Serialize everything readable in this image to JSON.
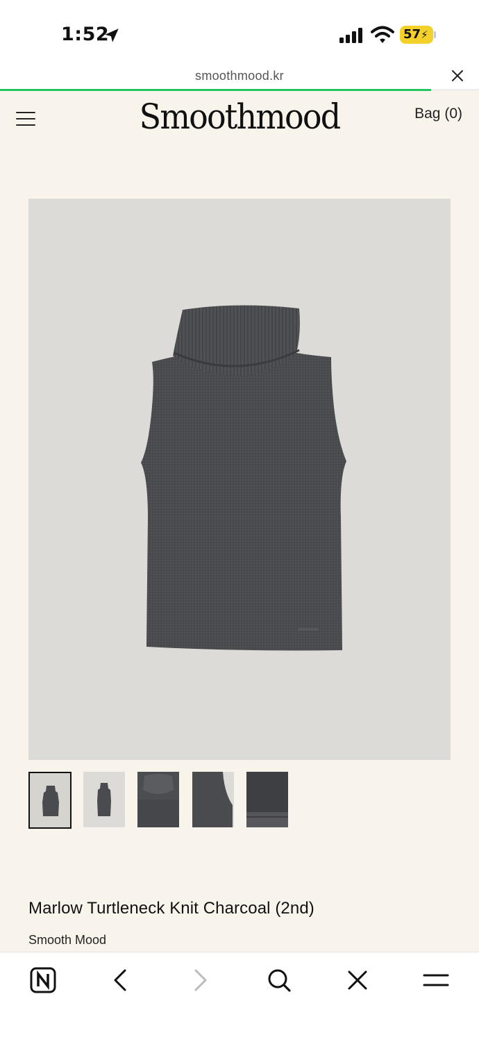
{
  "status_bar": {
    "time": "1:52",
    "battery": "57"
  },
  "browser": {
    "url": "smoothmood.kr",
    "load_progress": 0.9
  },
  "header": {
    "logo": "Smoothmood",
    "bag_label": "Bag (0)"
  },
  "product": {
    "title": "Marlow Turtleneck Knit Charcoal (2nd)",
    "brand": "Smooth Mood",
    "thumbnails": [
      "front-view",
      "front-view-small",
      "neck-detail",
      "side-detail",
      "fabric-detail"
    ],
    "selected_thumbnail": 0
  },
  "colors": {
    "background": "#f8f4ec",
    "progress": "#22c55e",
    "battery": "#f4d02a",
    "garment": "#4a4b4e"
  },
  "toolbar": {
    "icons": [
      "naver-n-icon",
      "back-icon",
      "forward-icon",
      "search-icon",
      "close-icon",
      "menu-icon"
    ]
  }
}
